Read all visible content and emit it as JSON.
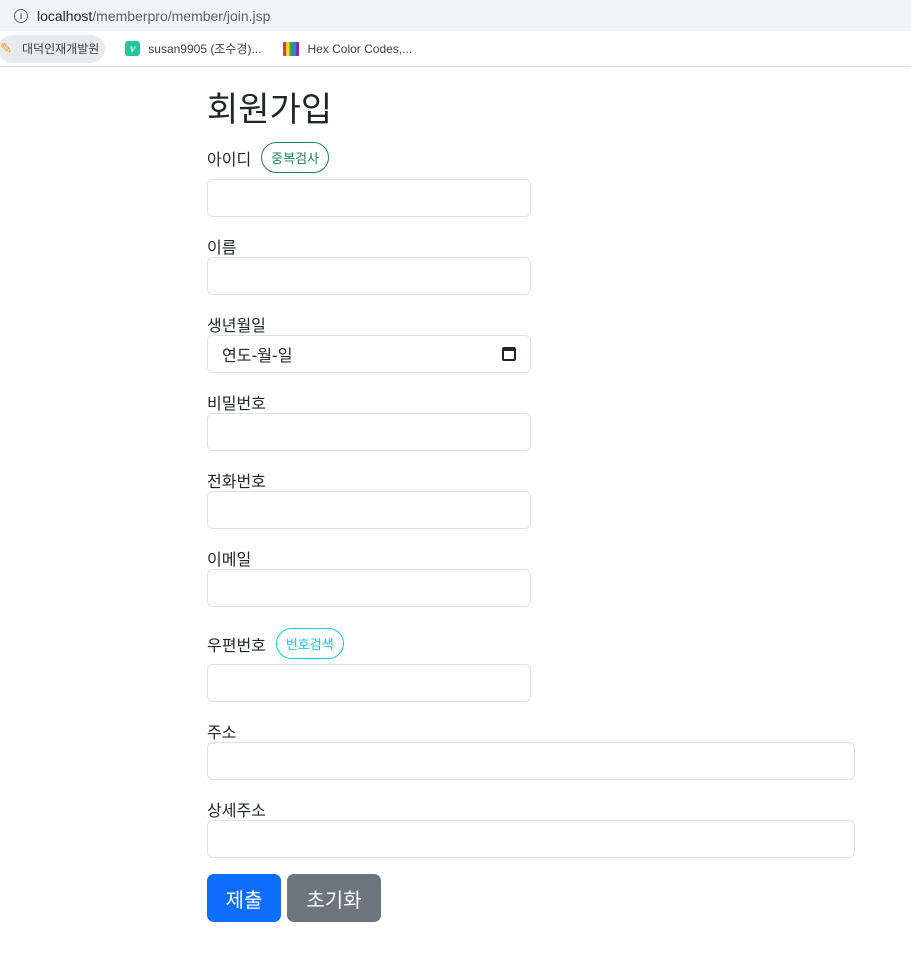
{
  "browser": {
    "url_host": "localhost",
    "url_path": "/memberpro/member/join.jsp",
    "bookmarks": [
      {
        "label": "대덕인재개발원",
        "icon": "pencil-icon"
      },
      {
        "label": "susan9905 (조수경)...",
        "icon": "vimeo-icon"
      },
      {
        "label": "Hex Color Codes,...",
        "icon": "hex-color-icon"
      }
    ]
  },
  "form": {
    "title": "회원가입",
    "id_label": "아이디",
    "id_check_button": "중복검사",
    "name_label": "이름",
    "birth_label": "생년월일",
    "birth_placeholder": "연도-월-일",
    "password_label": "비밀번호",
    "phone_label": "전화번호",
    "email_label": "이메일",
    "zip_label": "우편번호",
    "zip_search_button": "번호검색",
    "address_label": "주소",
    "address_detail_label": "상세주소",
    "submit_button": "제출",
    "reset_button": "초기화"
  },
  "colors": {
    "primary": "#0d6efd",
    "secondary": "#6c757d",
    "success": "#198754",
    "info": "#0dcaf0"
  }
}
